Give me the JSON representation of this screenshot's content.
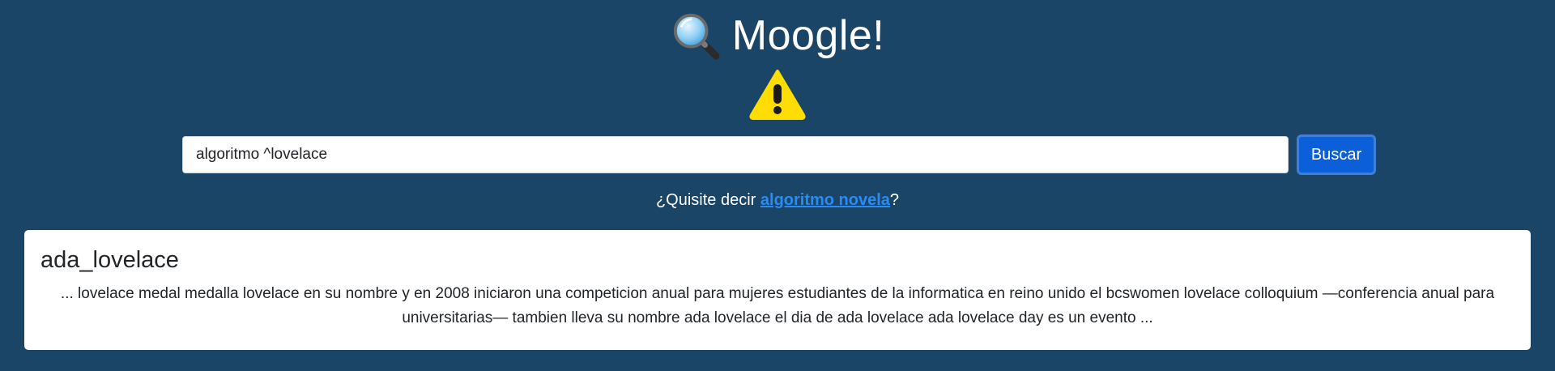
{
  "header": {
    "title": "Moogle!",
    "icon": "magnifying-glass-icon"
  },
  "warning": {
    "icon": "warning-icon",
    "color": "#ffdd00"
  },
  "search": {
    "value": "algoritmo ^lovelace",
    "button_label": "Buscar"
  },
  "suggestion": {
    "prefix": "¿Quisite decir ",
    "link_text": "algoritmo novela",
    "suffix": "?"
  },
  "results": [
    {
      "title": "ada_lovelace",
      "snippet": "... lovelace medal medalla lovelace en su nombre y en 2008 iniciaron una competicion anual para mujeres estudiantes de la informatica en reino unido el bcswomen lovelace colloquium —conferencia anual para universitarias— tambien lleva su nombre ada lovelace   el dia de ada lovelace ada lovelace day es un evento ..."
    }
  ],
  "colors": {
    "background": "#1b4567",
    "button": "#0b5fd8",
    "link": "#2a8cf2"
  }
}
